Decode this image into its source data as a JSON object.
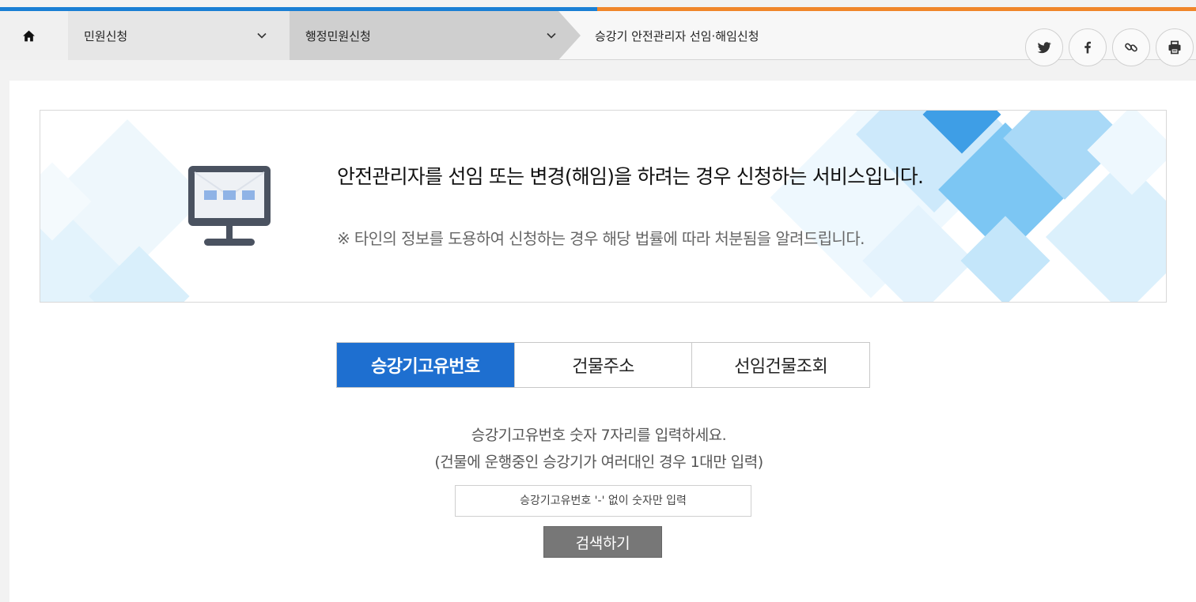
{
  "colors": {
    "strip_blue": "#1a7fd4",
    "strip_orange": "#f0862a",
    "tab_active": "#1e6fd0",
    "search_button": "#777777"
  },
  "breadcrumb": {
    "home_icon": "home-icon",
    "items": [
      {
        "label": "민원신청"
      },
      {
        "label": "행정민원신청"
      },
      {
        "label": "승강기 안전관리자 선임·해임신청"
      }
    ]
  },
  "share_icons": [
    "twitter-icon",
    "facebook-icon",
    "link-icon",
    "print-icon"
  ],
  "banner": {
    "title": "안전관리자를 선임 또는 변경(해임)을 하려는 경우 신청하는 서비스입니다.",
    "note": "※ 타인의 정보를 도용하여 신청하는 경우 해당 법률에 따라 처분됨을 알려드립니다.",
    "icon": "monitor-icon"
  },
  "tabs": [
    {
      "label": "승강기고유번호",
      "active": true
    },
    {
      "label": "건물주소",
      "active": false
    },
    {
      "label": "선임건물조회",
      "active": false
    }
  ],
  "guide": {
    "line1": "승강기고유번호 숫자 7자리를 입력하세요.",
    "line2": "(건물에 운행중인 승강기가 여러대인 경우 1대만 입력)"
  },
  "search": {
    "placeholder": "승강기고유번호 '-' 없이 숫자만 입력",
    "button_label": "검색하기"
  }
}
